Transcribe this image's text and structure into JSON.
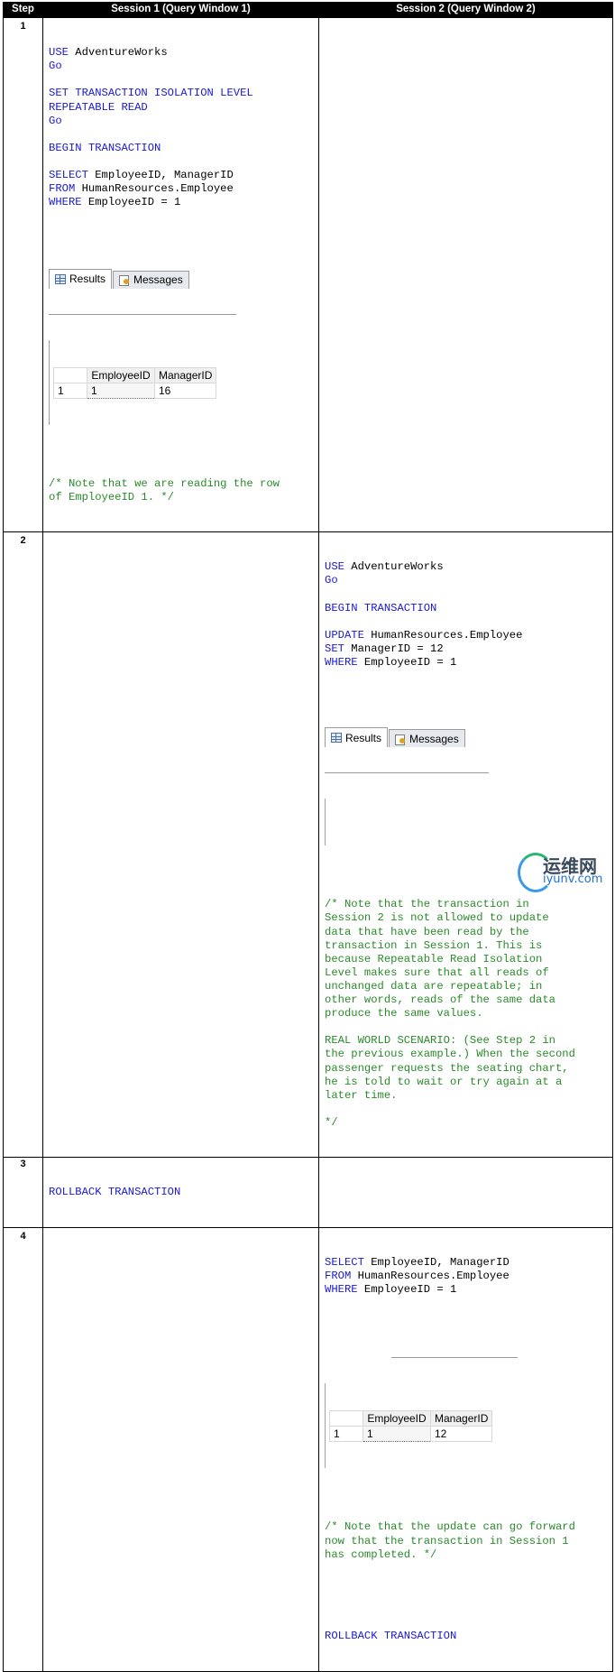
{
  "headers": {
    "step": "Step",
    "session1": "Session 1 (Query Window 1)",
    "session2": "Session 2 (Query Window 2)"
  },
  "steps": [
    {
      "number": "1",
      "session1": {
        "lines": [
          [
            [
              "kw",
              "USE "
            ],
            [
              "tx",
              "AdventureWorks"
            ]
          ],
          [
            [
              "kw",
              "Go"
            ]
          ],
          [],
          [
            [
              "kw",
              "SET TRANSACTION ISOLATION LEVEL"
            ]
          ],
          [
            [
              "kw",
              "REPEATABLE READ"
            ]
          ],
          [
            [
              "kw",
              "Go"
            ]
          ],
          [],
          [
            [
              "kw",
              "BEGIN TRANSACTION"
            ]
          ],
          [],
          [
            [
              "kw",
              "SELECT "
            ],
            [
              "tx",
              "EmployeeID, ManagerID"
            ]
          ],
          [
            [
              "kw",
              "FROM "
            ],
            [
              "tx",
              "HumanResources.Employee"
            ]
          ],
          [
            [
              "kw",
              "WHERE "
            ],
            [
              "tx",
              "EmployeeID = 1"
            ]
          ]
        ],
        "results": {
          "tabs": [
            "Results",
            "Messages"
          ],
          "columns": [
            "EmployeeID",
            "ManagerID"
          ],
          "rows": [
            [
              "1",
              "1",
              "16"
            ]
          ]
        },
        "comment": [
          "/* Note that we are reading the row",
          "of EmployeeID 1. */"
        ]
      },
      "session2": {
        "lines": []
      }
    },
    {
      "number": "2",
      "session1": {
        "lines": []
      },
      "session2": {
        "lines": [
          [
            [
              "kw",
              "USE "
            ],
            [
              "tx",
              "AdventureWorks"
            ]
          ],
          [
            [
              "kw",
              "Go"
            ]
          ],
          [],
          [
            [
              "kw",
              "BEGIN TRANSACTION"
            ]
          ],
          [],
          [
            [
              "kw",
              "UPDATE "
            ],
            [
              "tx",
              "HumanResources.Employee"
            ]
          ],
          [
            [
              "kw",
              "SET "
            ],
            [
              "tx",
              "ManagerID = 12"
            ]
          ],
          [
            [
              "kw",
              "WHERE "
            ],
            [
              "tx",
              "EmployeeID = 1"
            ]
          ]
        ],
        "results": {
          "tabs": [
            "Results",
            "Messages"
          ]
        },
        "comment": [
          "/* Note that the transaction in",
          "Session 2 is not allowed to update",
          "data that have been read by the",
          "transaction in Session 1. This is",
          "because Repeatable Read Isolation",
          "Level makes sure that all reads of",
          "unchanged data are repeatable; in",
          "other words, reads of the same data",
          "produce the same values.",
          "",
          "REAL WORLD SCENARIO: (See Step 2 in",
          "the previous example.) When the second",
          "passenger requests the seating chart,",
          "he is told to wait or try again at a",
          "later time.",
          "",
          "*/"
        ]
      }
    },
    {
      "number": "3",
      "session1": {
        "lines": [
          [
            [
              "kw",
              "ROLLBACK TRANSACTION"
            ]
          ]
        ]
      },
      "session2": {
        "lines": []
      }
    },
    {
      "number": "4",
      "session1": {
        "lines": []
      },
      "session2": {
        "lines": [
          [
            [
              "kw",
              "SELECT "
            ],
            [
              "tx",
              "EmployeeID, ManagerID"
            ]
          ],
          [
            [
              "kw",
              "FROM "
            ],
            [
              "tx",
              "HumanResources.Employee"
            ]
          ],
          [
            [
              "kw",
              "WHERE "
            ],
            [
              "tx",
              "EmployeeID = 1"
            ]
          ]
        ],
        "results": {
          "columns": [
            "EmployeeID",
            "ManagerID"
          ],
          "rows": [
            [
              "1",
              "1",
              "12"
            ]
          ]
        },
        "comment": [
          "/* Note that the update can go forward",
          "now that the transaction in Session 1",
          "has completed. */"
        ],
        "after": [
          [
            [
              "kw",
              "ROLLBACK TRANSACTION"
            ]
          ]
        ]
      }
    }
  ],
  "watermark": {
    "brand": "运维网",
    "url": "iyunv.com"
  }
}
